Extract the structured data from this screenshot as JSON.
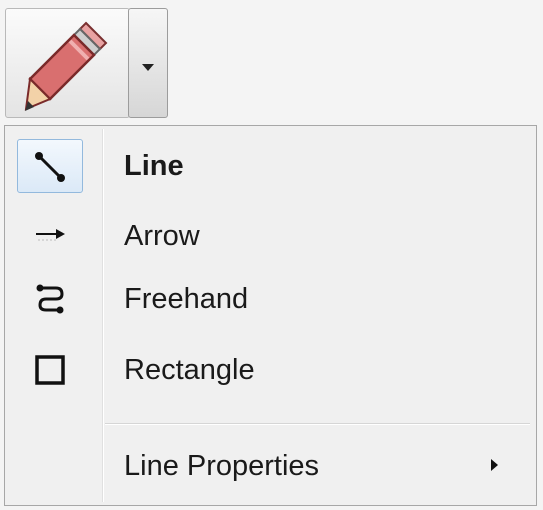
{
  "toolbar": {
    "tool_icon": "pencil-icon",
    "dropdown_icon": "chevron-down-icon"
  },
  "menu": {
    "items": [
      {
        "label": "Line",
        "icon": "line-icon",
        "checked": true
      },
      {
        "label": "Arrow",
        "icon": "arrow-icon",
        "checked": false
      },
      {
        "label": "Freehand",
        "icon": "freehand-icon",
        "checked": false
      },
      {
        "label": "Rectangle",
        "icon": "rectangle-icon",
        "checked": false
      }
    ],
    "properties": {
      "label": "Line Properties",
      "icon": "submenu-arrow-icon"
    }
  },
  "colors": {
    "pencil_body": "#d96f6f",
    "highlight_border": "#93b9dd",
    "menu_background": "#f0f0f0"
  }
}
